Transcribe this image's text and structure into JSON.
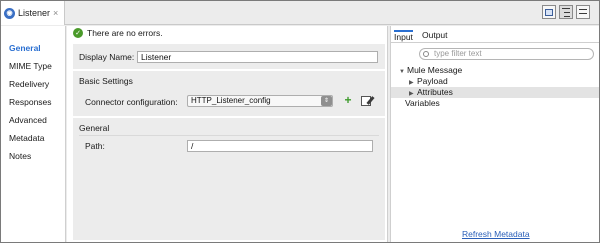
{
  "tab": {
    "label": "Listener",
    "close": "×",
    "icon": "listener-icon"
  },
  "leftnav": {
    "items": [
      {
        "label": "General",
        "active": true
      },
      {
        "label": "MIME Type"
      },
      {
        "label": "Redelivery"
      },
      {
        "label": "Responses"
      },
      {
        "label": "Advanced"
      },
      {
        "label": "Metadata"
      },
      {
        "label": "Notes"
      }
    ]
  },
  "status": {
    "text": "There are no errors."
  },
  "form": {
    "display_name_label": "Display Name:",
    "display_name_value": "Listener",
    "basic_settings_title": "Basic Settings",
    "connector_label": "Connector configuration:",
    "connector_value": "HTTP_Listener_config",
    "general_title": "General",
    "path_label": "Path:",
    "path_value": "/"
  },
  "right": {
    "tabs": [
      {
        "label": "Input",
        "active": true
      },
      {
        "label": "Output"
      }
    ],
    "filter_placeholder": "type filter text",
    "tree": [
      {
        "label": "Mule Message",
        "level": 0,
        "expanded": true
      },
      {
        "label": "Payload",
        "level": 1,
        "expanded": false
      },
      {
        "label": "Attributes",
        "level": 1,
        "expanded": false,
        "selected": true
      },
      {
        "label": "Variables",
        "level": 0
      }
    ],
    "refresh_label": "Refresh Metadata"
  },
  "colors": {
    "accent": "#2a6fd1",
    "ok": "#4a9a2a",
    "add": "#3d9b2b"
  }
}
